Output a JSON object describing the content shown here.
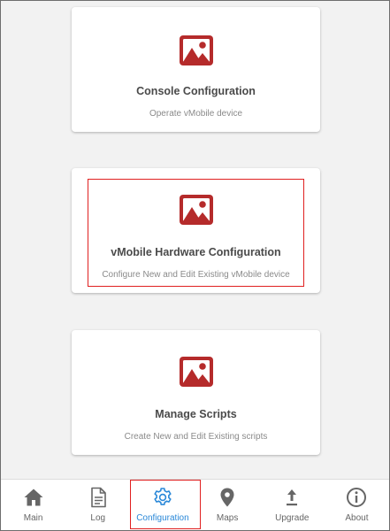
{
  "cards": [
    {
      "title": "Console Configuration",
      "subtitle": "Operate vMobile device",
      "icon": "image-icon"
    },
    {
      "title": "vMobile Hardware Configuration",
      "subtitle": "Configure New and Edit Existing vMobile device",
      "icon": "image-icon"
    },
    {
      "title": "Manage Scripts",
      "subtitle": "Create New and Edit Existing scripts",
      "icon": "image-icon"
    }
  ],
  "tabs": [
    {
      "label": "Main",
      "icon": "home-icon"
    },
    {
      "label": "Log",
      "icon": "document-icon"
    },
    {
      "label": "Configuration",
      "icon": "gear-icon",
      "active": true
    },
    {
      "label": "Maps",
      "icon": "map-pin-icon"
    },
    {
      "label": "Upgrade",
      "icon": "upload-icon"
    },
    {
      "label": "About",
      "icon": "info-icon"
    }
  ],
  "colors": {
    "icon_red": "#b52b2b",
    "active_blue": "#2a88d8",
    "highlight": "#e02020",
    "tab_icon": "#666666"
  }
}
